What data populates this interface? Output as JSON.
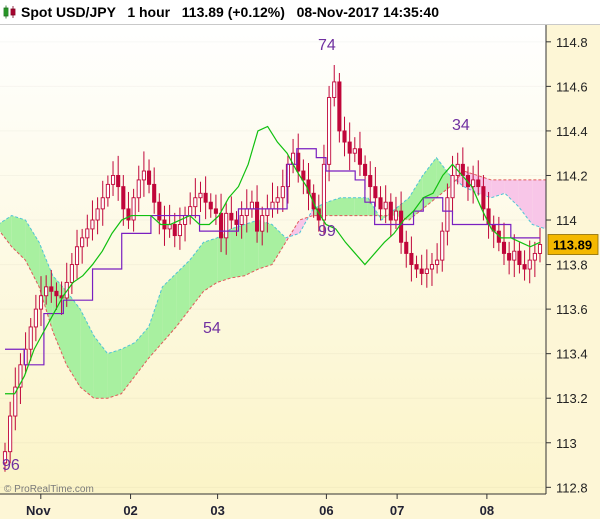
{
  "header": {
    "title": "Spot USD/JPY   1 hour   113.89 (+0.12%)   08-Nov-2017 14:35:40",
    "icon": "candlestick-chart-icon"
  },
  "watermark": "© ProRealTime.com",
  "last_price_label": "113.89",
  "colors": {
    "candle": "#c0063a",
    "tenkan": "#7a1fc0",
    "kijun": "#10c010",
    "cloud_bullish": "#a8f0a0",
    "cloud_bearish": "#f8c6e8",
    "background_top": "#ffffff",
    "background_bottom": "#fbf4c7",
    "annotation": "#7030a0",
    "price_tag": "#f4b800"
  },
  "chart_data": {
    "type": "candlestick",
    "symbol": "Spot USD/JPY",
    "timeframe": "1 hour",
    "ylim": [
      112.77,
      114.88
    ],
    "y_ticks": [
      "114.8",
      "114.6",
      "114.4",
      "114.2",
      "114",
      "113.8",
      "113.6",
      "113.4",
      "113.2",
      "113",
      "112.8"
    ],
    "x_ticks": [
      "Nov",
      "02",
      "03",
      "06",
      "07",
      "08"
    ],
    "annotations": [
      "96",
      "54",
      "74",
      "99",
      "34"
    ],
    "last_price": 113.89,
    "closes": [
      112.96,
      113.12,
      113.25,
      113.35,
      113.42,
      113.52,
      113.6,
      113.66,
      113.7,
      113.68,
      113.66,
      113.65,
      113.72,
      113.8,
      113.88,
      113.92,
      113.96,
      114.0,
      114.05,
      114.1,
      114.16,
      114.2,
      114.15,
      114.05,
      114.0,
      114.1,
      114.18,
      114.22,
      114.16,
      114.08,
      114.0,
      113.96,
      113.98,
      113.93,
      113.98,
      114.02,
      114.06,
      114.1,
      114.12,
      114.08,
      114.05,
      114.03,
      113.92,
      114.03,
      114.0,
      113.98,
      114.02,
      114.05,
      114.08,
      113.95,
      114.02,
      114.05,
      114.08,
      114.1,
      114.15,
      114.25,
      114.3,
      114.22,
      114.18,
      114.12,
      114.05,
      114.0,
      114.25,
      114.55,
      114.62,
      114.4,
      114.35,
      114.3,
      114.32,
      114.25,
      114.2,
      114.15,
      114.1,
      114.05,
      114.08,
      114.0,
      114.04,
      113.9,
      113.85,
      113.8,
      113.78,
      113.76,
      113.78,
      113.8,
      113.82,
      113.95,
      114.1,
      114.2,
      114.25,
      114.2,
      114.15,
      114.18,
      114.15,
      114.05,
      113.98,
      113.95,
      113.9,
      113.85,
      113.82,
      113.86,
      113.8,
      113.78,
      113.82,
      113.85,
      113.89
    ],
    "tenkan": [
      113.42,
      113.42,
      113.35,
      113.35,
      113.58,
      113.58,
      113.64,
      113.64,
      113.64,
      113.78,
      113.78,
      113.78,
      113.94,
      113.94,
      113.94,
      114.02,
      114.02,
      114.02,
      114.02,
      114.02,
      113.95,
      113.95,
      113.95,
      113.95,
      114.05,
      114.05,
      114.05,
      114.05,
      114.05,
      114.25,
      114.32,
      114.32,
      114.28,
      114.22,
      114.22,
      114.22,
      114.18,
      114.08,
      113.98,
      113.98,
      113.98,
      113.98,
      114.04,
      114.1,
      114.1,
      114.04,
      113.98,
      113.98,
      113.98,
      113.98,
      113.98,
      113.98,
      113.92,
      113.92,
      113.92,
      113.92
    ],
    "kijun": [
      113.22,
      113.22,
      113.3,
      113.42,
      113.5,
      113.58,
      113.66,
      113.72,
      113.75,
      113.8,
      113.86,
      113.94,
      114.0,
      114.02,
      114.02,
      114.02,
      113.98,
      113.98,
      114.0,
      114.02,
      113.98,
      113.98,
      114.02,
      114.1,
      114.15,
      114.25,
      114.4,
      114.42,
      114.35,
      114.3,
      114.22,
      114.15,
      114.05,
      113.98,
      113.96,
      113.9,
      113.85,
      113.8,
      113.85,
      113.9,
      113.94,
      114.0,
      114.04,
      114.1,
      114.12,
      114.2,
      114.25,
      114.2,
      114.15,
      114.05,
      113.96,
      113.92,
      113.92,
      113.9,
      113.88,
      113.9
    ],
    "span_a": [
      113.98,
      114.02,
      114.0,
      113.9,
      113.75,
      113.68,
      113.6,
      113.48,
      113.4,
      113.42,
      113.45,
      113.52,
      113.7,
      113.76,
      113.82,
      113.9,
      113.92,
      113.96,
      113.98,
      114.0,
      113.98,
      113.92,
      113.94,
      114.05,
      114.08,
      114.1,
      114.1,
      114.1,
      114.0,
      114.05,
      114.1,
      114.2,
      114.28,
      114.2,
      114.15,
      114.12,
      114.1,
      114.12,
      114.06,
      113.98,
      113.96
    ],
    "span_b": [
      113.96,
      113.88,
      113.82,
      113.7,
      113.5,
      113.35,
      113.25,
      113.2,
      113.2,
      113.22,
      113.3,
      113.38,
      113.45,
      113.52,
      113.6,
      113.68,
      113.72,
      113.74,
      113.75,
      113.78,
      113.8,
      113.9,
      114.0,
      114.02,
      114.02,
      114.02,
      114.02,
      114.02,
      114.02,
      114.02,
      114.0,
      114.05,
      114.1,
      114.15,
      114.22,
      114.2,
      114.18,
      114.18,
      114.18,
      114.18,
      114.18
    ]
  }
}
